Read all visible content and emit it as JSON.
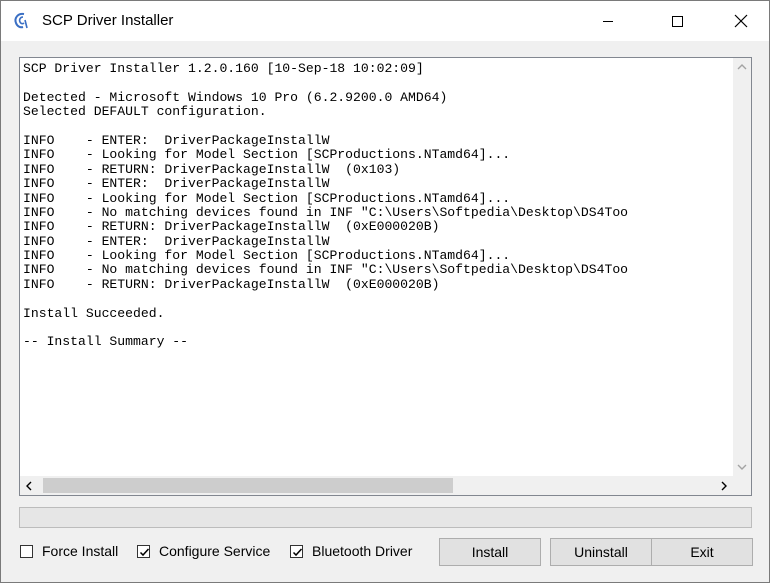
{
  "window": {
    "title": "SCP Driver Installer",
    "controls": {
      "minimize": "minimize",
      "maximize": "maximize",
      "close": "close"
    }
  },
  "log": {
    "lines": [
      "SCP Driver Installer 1.2.0.160 [10-Sep-18 10:02:09]",
      "",
      "Detected - Microsoft Windows 10 Pro (6.2.9200.0 AMD64)",
      "Selected DEFAULT configuration.",
      "",
      "INFO    - ENTER:  DriverPackageInstallW",
      "INFO    - Looking for Model Section [SCProductions.NTamd64]...",
      "INFO    - RETURN: DriverPackageInstallW  (0x103)",
      "INFO    - ENTER:  DriverPackageInstallW",
      "INFO    - Looking for Model Section [SCProductions.NTamd64]...",
      "INFO    - No matching devices found in INF \"C:\\Users\\Softpedia\\Desktop\\DS4Too",
      "INFO    - RETURN: DriverPackageInstallW  (0xE000020B)",
      "INFO    - ENTER:  DriverPackageInstallW",
      "INFO    - Looking for Model Section [SCProductions.NTamd64]...",
      "INFO    - No matching devices found in INF \"C:\\Users\\Softpedia\\Desktop\\DS4Too",
      "INFO    - RETURN: DriverPackageInstallW  (0xE000020B)",
      "",
      "Install Succeeded.",
      "",
      "-- Install Summary --"
    ]
  },
  "progress": {
    "value": 0
  },
  "options": {
    "force_install": {
      "label": "Force Install",
      "checked": false
    },
    "configure_service": {
      "label": "Configure Service",
      "checked": true
    },
    "bluetooth_driver": {
      "label": "Bluetooth Driver",
      "checked": true
    }
  },
  "buttons": {
    "install": "Install",
    "uninstall": "Uninstall",
    "exit": "Exit"
  },
  "icons": {
    "app": "scp-logo-icon",
    "scroll_up": "chevron-up-icon",
    "scroll_down": "chevron-down-icon",
    "scroll_left": "chevron-left-icon",
    "scroll_right": "chevron-right-icon"
  },
  "colors": {
    "accent": "#3a6fc4",
    "titlebar": "#ffffff",
    "window_bg": "#f0f0f0"
  }
}
